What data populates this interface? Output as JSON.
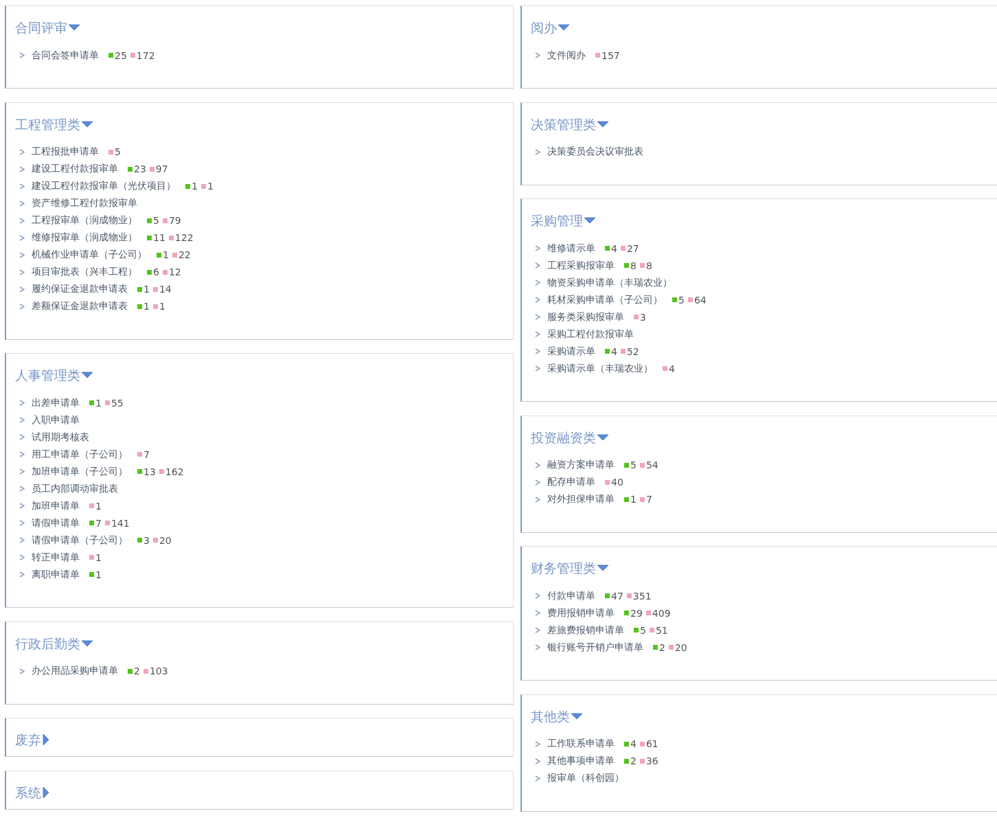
{
  "columns": [
    {
      "groups": [
        {
          "title": "合同评审",
          "expanded": true,
          "items": [
            {
              "label": "合同会签申请单",
              "counts": [
                {
                  "value": "25",
                  "color": "#52c41a"
                },
                {
                  "value": "172",
                  "color": "#f0a6b8"
                }
              ]
            }
          ]
        },
        {
          "title": "工程管理类",
          "expanded": true,
          "items": [
            {
              "label": "工程报批申请单",
              "counts": [
                {
                  "value": "5",
                  "color": "#f0a6b8"
                }
              ]
            },
            {
              "label": "建设工程付款报审单",
              "counts": [
                {
                  "value": "23",
                  "color": "#52c41a"
                },
                {
                  "value": "97",
                  "color": "#f0a6b8"
                }
              ]
            },
            {
              "label": "建设工程付款报审单（光伏项目）",
              "counts": [
                {
                  "value": "1",
                  "color": "#52c41a"
                },
                {
                  "value": "1",
                  "color": "#f0a6b8"
                }
              ]
            },
            {
              "label": "资产维修工程付款报审单"
            },
            {
              "label": "工程报审单（润成物业）",
              "counts": [
                {
                  "value": "5",
                  "color": "#52c41a"
                },
                {
                  "value": "79",
                  "color": "#f0a6b8"
                }
              ]
            },
            {
              "label": "维修报审单（润成物业）",
              "counts": [
                {
                  "value": "11",
                  "color": "#52c41a"
                },
                {
                  "value": "122",
                  "color": "#f0a6b8"
                }
              ]
            },
            {
              "label": "机械作业申请单（子公司）",
              "counts": [
                {
                  "value": "1",
                  "color": "#52c41a"
                },
                {
                  "value": "22",
                  "color": "#f0a6b8"
                }
              ]
            },
            {
              "label": "项目审批表（兴丰工程）",
              "counts": [
                {
                  "value": "6",
                  "color": "#52c41a"
                },
                {
                  "value": "12",
                  "color": "#f0a6b8"
                }
              ]
            },
            {
              "label": "履约保证金退款申请表",
              "counts": [
                {
                  "value": "1",
                  "color": "#52c41a"
                },
                {
                  "value": "14",
                  "color": "#f0a6b8"
                }
              ]
            },
            {
              "label": "差额保证金退款申请表",
              "counts": [
                {
                  "value": "1",
                  "color": "#52c41a"
                },
                {
                  "value": "1",
                  "color": "#f0a6b8"
                }
              ]
            }
          ]
        },
        {
          "title": "人事管理类",
          "expanded": true,
          "items": [
            {
              "label": "出差申请单",
              "counts": [
                {
                  "value": "1",
                  "color": "#52c41a"
                },
                {
                  "value": "55",
                  "color": "#f0a6b8"
                }
              ]
            },
            {
              "label": "入职申请单"
            },
            {
              "label": "试用期考核表"
            },
            {
              "label": "用工申请单（子公司）",
              "counts": [
                {
                  "value": "7",
                  "color": "#f0a6b8"
                }
              ]
            },
            {
              "label": "加班申请单（子公司）",
              "counts": [
                {
                  "value": "13",
                  "color": "#52c41a"
                },
                {
                  "value": "162",
                  "color": "#f0a6b8"
                }
              ]
            },
            {
              "label": "员工内部调动审批表"
            },
            {
              "label": "加班申请单",
              "counts": [
                {
                  "value": "1",
                  "color": "#f0a6b8"
                }
              ]
            },
            {
              "label": "请假申请单",
              "counts": [
                {
                  "value": "7",
                  "color": "#52c41a"
                },
                {
                  "value": "141",
                  "color": "#f0a6b8"
                }
              ]
            },
            {
              "label": "请假申请单（子公司）",
              "counts": [
                {
                  "value": "3",
                  "color": "#52c41a"
                },
                {
                  "value": "20",
                  "color": "#f0a6b8"
                }
              ]
            },
            {
              "label": "转正申请单",
              "counts": [
                {
                  "value": "1",
                  "color": "#f0a6b8"
                }
              ]
            },
            {
              "label": "离职申请单",
              "counts": [
                {
                  "value": "1",
                  "color": "#52c41a"
                }
              ]
            }
          ]
        },
        {
          "title": "行政后勤类",
          "expanded": true,
          "items": [
            {
              "label": "办公用品采购申请单",
              "counts": [
                {
                  "value": "2",
                  "color": "#52c41a"
                },
                {
                  "value": "103",
                  "color": "#f0a6b8"
                }
              ]
            }
          ]
        },
        {
          "title": "废弃",
          "expanded": false
        },
        {
          "title": "系统",
          "expanded": false
        }
      ]
    },
    {
      "groups": [
        {
          "title": "阅办",
          "expanded": true,
          "items": [
            {
              "label": "文件阅办",
              "counts": [
                {
                  "value": "157",
                  "color": "#f0a6b8"
                }
              ]
            }
          ]
        },
        {
          "title": "决策管理类",
          "expanded": true,
          "items": [
            {
              "label": "决策委员会决议审批表"
            }
          ]
        },
        {
          "title": "采购管理",
          "expanded": true,
          "items": [
            {
              "label": "维修请示单",
              "counts": [
                {
                  "value": "4",
                  "color": "#52c41a"
                },
                {
                  "value": "27",
                  "color": "#f0a6b8"
                }
              ]
            },
            {
              "label": "工程采购报审单",
              "counts": [
                {
                  "value": "8",
                  "color": "#52c41a"
                },
                {
                  "value": "8",
                  "color": "#f0a6b8"
                }
              ]
            },
            {
              "label": "物资采购申请单（丰瑞农业）"
            },
            {
              "label": "耗材采购申请单（子公司）",
              "counts": [
                {
                  "value": "5",
                  "color": "#52c41a"
                },
                {
                  "value": "64",
                  "color": "#f0a6b8"
                }
              ]
            },
            {
              "label": "服务类采购报审单",
              "counts": [
                {
                  "value": "3",
                  "color": "#f0a6b8"
                }
              ]
            },
            {
              "label": "采购工程付款报审单"
            },
            {
              "label": "采购请示单",
              "counts": [
                {
                  "value": "4",
                  "color": "#52c41a"
                },
                {
                  "value": "52",
                  "color": "#f0a6b8"
                }
              ]
            },
            {
              "label": "采购请示单（丰瑞农业）",
              "counts": [
                {
                  "value": "4",
                  "color": "#f0a6b8"
                }
              ]
            }
          ]
        },
        {
          "title": "投资融资类",
          "expanded": true,
          "items": [
            {
              "label": "融资方案申请单",
              "counts": [
                {
                  "value": "5",
                  "color": "#52c41a"
                },
                {
                  "value": "54",
                  "color": "#f0a6b8"
                }
              ]
            },
            {
              "label": "配存申请单",
              "counts": [
                {
                  "value": "40",
                  "color": "#f0a6b8"
                }
              ]
            },
            {
              "label": "对外担保申请单",
              "counts": [
                {
                  "value": "1",
                  "color": "#52c41a"
                },
                {
                  "value": "7",
                  "color": "#f0a6b8"
                }
              ]
            }
          ]
        },
        {
          "title": "财务管理类",
          "expanded": true,
          "items": [
            {
              "label": "付款申请单",
              "counts": [
                {
                  "value": "47",
                  "color": "#52c41a"
                },
                {
                  "value": "351",
                  "color": "#f0a6b8"
                }
              ]
            },
            {
              "label": "费用报销申请单",
              "counts": [
                {
                  "value": "29",
                  "color": "#52c41a"
                },
                {
                  "value": "409",
                  "color": "#f0a6b8"
                }
              ]
            },
            {
              "label": "差旅费报销申请单",
              "counts": [
                {
                  "value": "5",
                  "color": "#52c41a"
                },
                {
                  "value": "51",
                  "color": "#f0a6b8"
                }
              ]
            },
            {
              "label": "银行账号开销户申请单",
              "counts": [
                {
                  "value": "2",
                  "color": "#52c41a"
                },
                {
                  "value": "20",
                  "color": "#f0a6b8"
                }
              ]
            }
          ]
        },
        {
          "title": "其他类",
          "expanded": true,
          "items": [
            {
              "label": "工作联系申请单",
              "counts": [
                {
                  "value": "4",
                  "color": "#52c41a"
                },
                {
                  "value": "61",
                  "color": "#f0a6b8"
                }
              ]
            },
            {
              "label": "其他事项申请单",
              "counts": [
                {
                  "value": "2",
                  "color": "#52c41a"
                },
                {
                  "value": "36",
                  "color": "#f0a6b8"
                }
              ]
            },
            {
              "label": "报审单（科创园）"
            }
          ]
        }
      ]
    }
  ]
}
